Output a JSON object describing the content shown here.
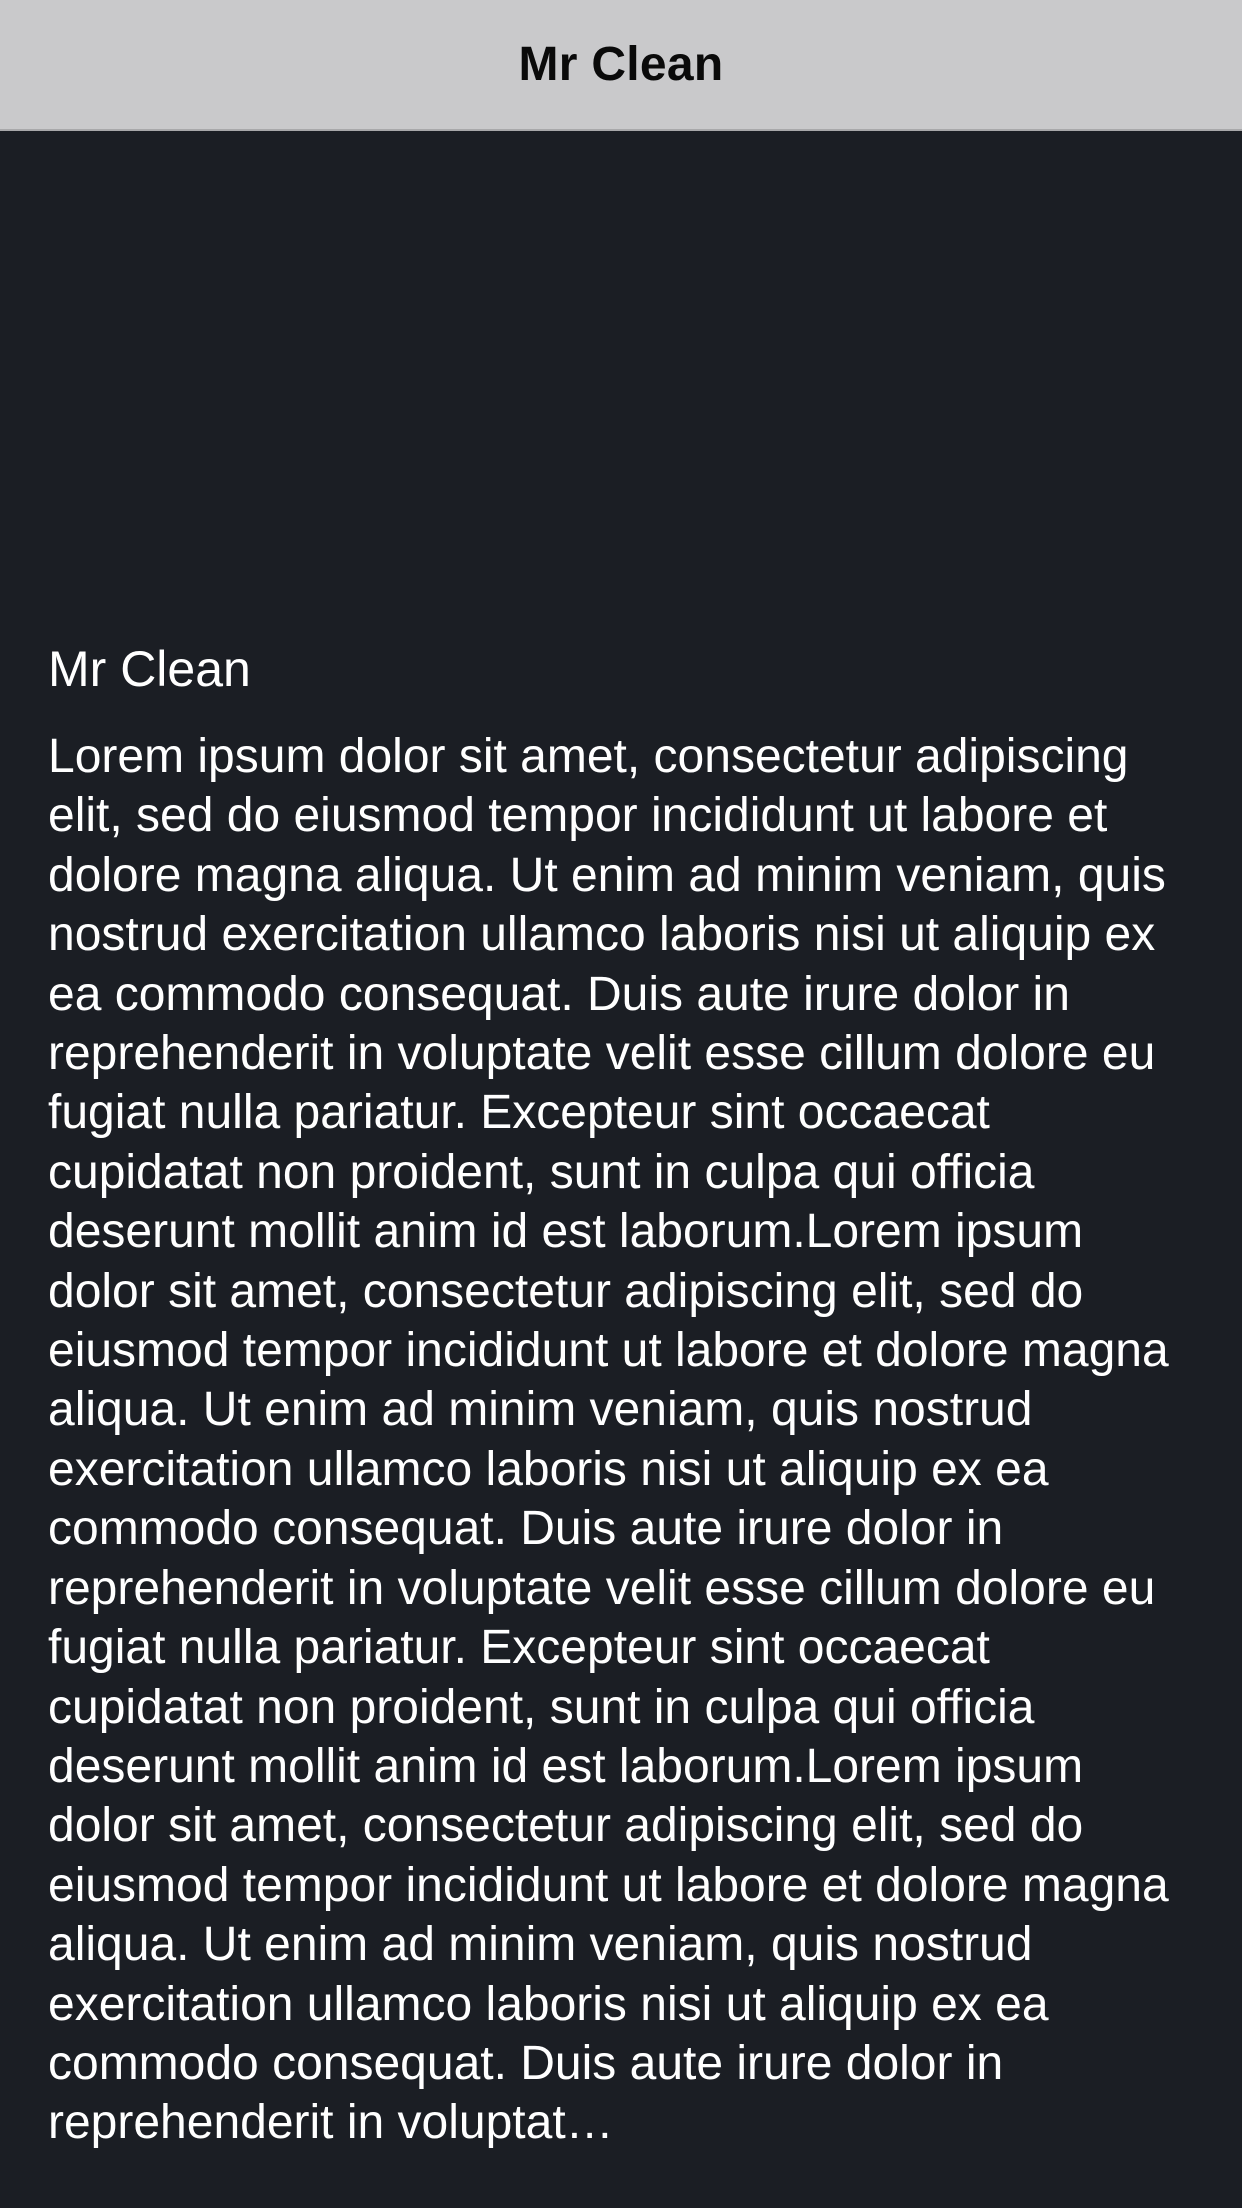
{
  "nav": {
    "title": "Mr Clean"
  },
  "detail": {
    "title": "Mr Clean",
    "body": "Lorem ipsum dolor sit amet, consectetur adipiscing elit, sed do eiusmod tempor incididunt ut labore et dolore magna aliqua. Ut enim ad minim veniam, quis nostrud exercitation ullamco laboris nisi ut aliquip ex ea commodo consequat. Duis aute irure dolor in reprehenderit in voluptate velit esse cillum dolore eu fugiat nulla pariatur. Excepteur sint occaecat cupidatat non proident, sunt in culpa qui officia deserunt mollit anim id est laborum.Lorem ipsum dolor sit amet, consectetur adipiscing elit, sed do eiusmod tempor incididunt ut labore et dolore magna aliqua. Ut enim ad minim veniam, quis nostrud exercitation ullamco laboris nisi ut aliquip ex ea commodo consequat. Duis aute irure dolor in reprehenderit in voluptate velit esse cillum dolore eu fugiat nulla pariatur. Excepteur sint occaecat cupidatat non proident, sunt in culpa qui officia deserunt mollit anim id est laborum.Lorem ipsum dolor sit amet, consectetur adipiscing elit, sed do eiusmod tempor incididunt ut labore et dolore magna aliqua. Ut enim ad minim veniam, quis nostrud exercitation ullamco laboris nisi ut aliquip ex ea commodo consequat. Duis aute irure dolor in reprehenderit in voluptat…"
  },
  "colors": {
    "nav_background": "#c9c9cb",
    "content_background": "#1b1e24",
    "text": "#ffffff"
  }
}
